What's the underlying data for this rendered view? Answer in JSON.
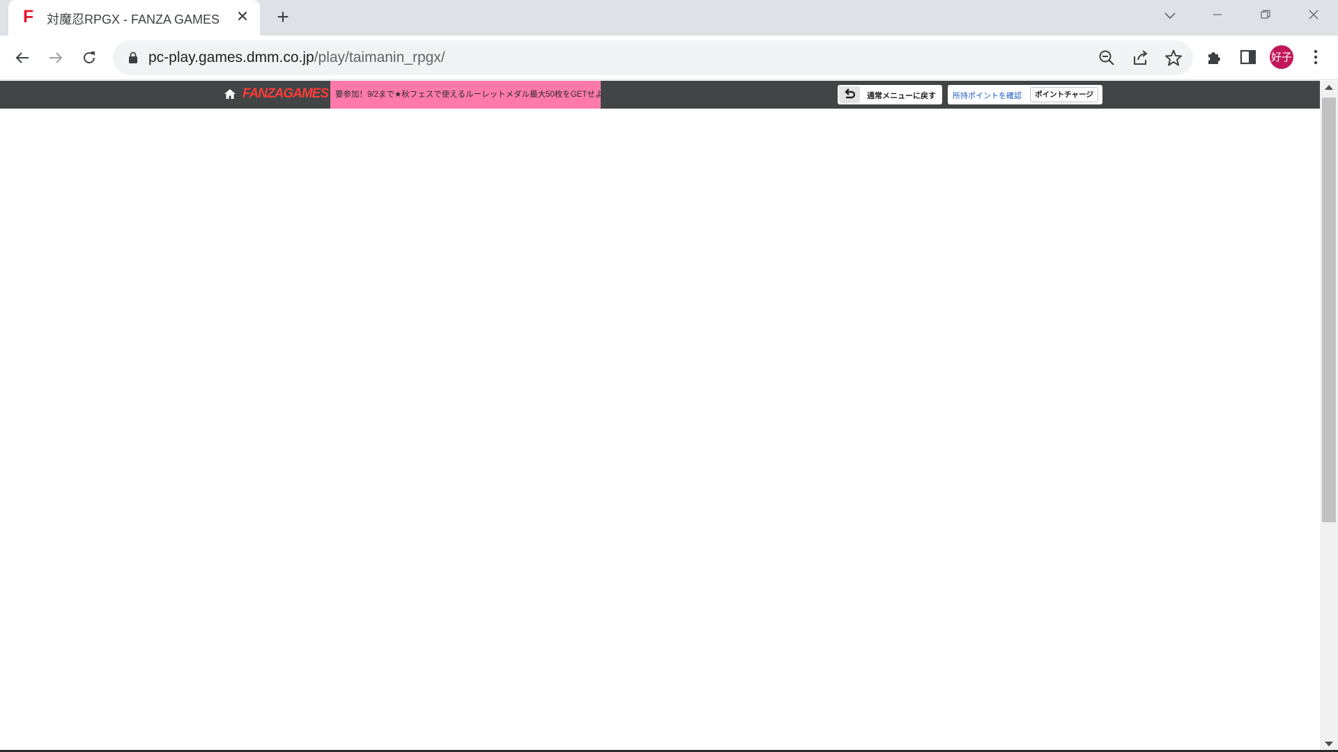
{
  "browser": {
    "tab": {
      "title": "対魔忍RPGX - FANZA GAMES",
      "favicon_letter": "F"
    },
    "new_tab_symbol": "+",
    "tab_close_symbol": "✕",
    "url": {
      "host": "pc-play.games.dmm.co.jp",
      "path": "/play/taimanin_rpgx/"
    },
    "profile_avatar": "好子",
    "icons": [
      "back-icon",
      "forward-icon",
      "reload-icon",
      "lock-icon",
      "zoom-out-icon",
      "share-icon",
      "star-icon",
      "extensions-icon",
      "side-panel-icon",
      "menu-icon"
    ],
    "window_controls": {
      "minimize": "─",
      "restore": "❐",
      "close": "✕",
      "tab_search": "⌄"
    }
  },
  "page": {
    "topbar": {
      "brand": "FANZAGAMES",
      "promo_text": "要参加！9/2まで★秋フェスで使えるルーレットメダル最大50枚をGETせよ",
      "back_menu_label": "通常メニューに戻す",
      "check_points_label": "所持ポイントを確認",
      "point_charge_label": "ポイントチャージ"
    }
  },
  "colors": {
    "topbar_bg": "#414545",
    "promo_bg": "#ff7aa8",
    "brand": "#ff3a3a",
    "avatar_bg": "#c2185b",
    "link_blue": "#1a56c4"
  }
}
